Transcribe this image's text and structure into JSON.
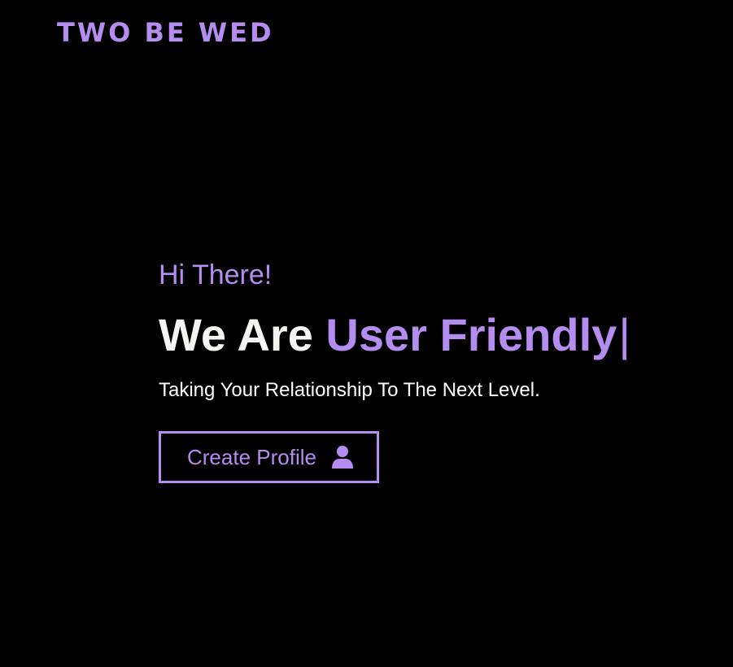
{
  "header": {
    "brand": "TWO BE WED"
  },
  "hero": {
    "greeting": "Hi There!",
    "headline_prefix": "We Are ",
    "headline_accent": "User Friendly",
    "cursor": "|",
    "tagline": "Taking Your Relationship To The Next Level.",
    "cta_label": "Create Profile",
    "cta_icon": "user-icon"
  },
  "colors": {
    "background": "#000000",
    "accent": "#b58cf0",
    "text": "#f4f4f0"
  }
}
